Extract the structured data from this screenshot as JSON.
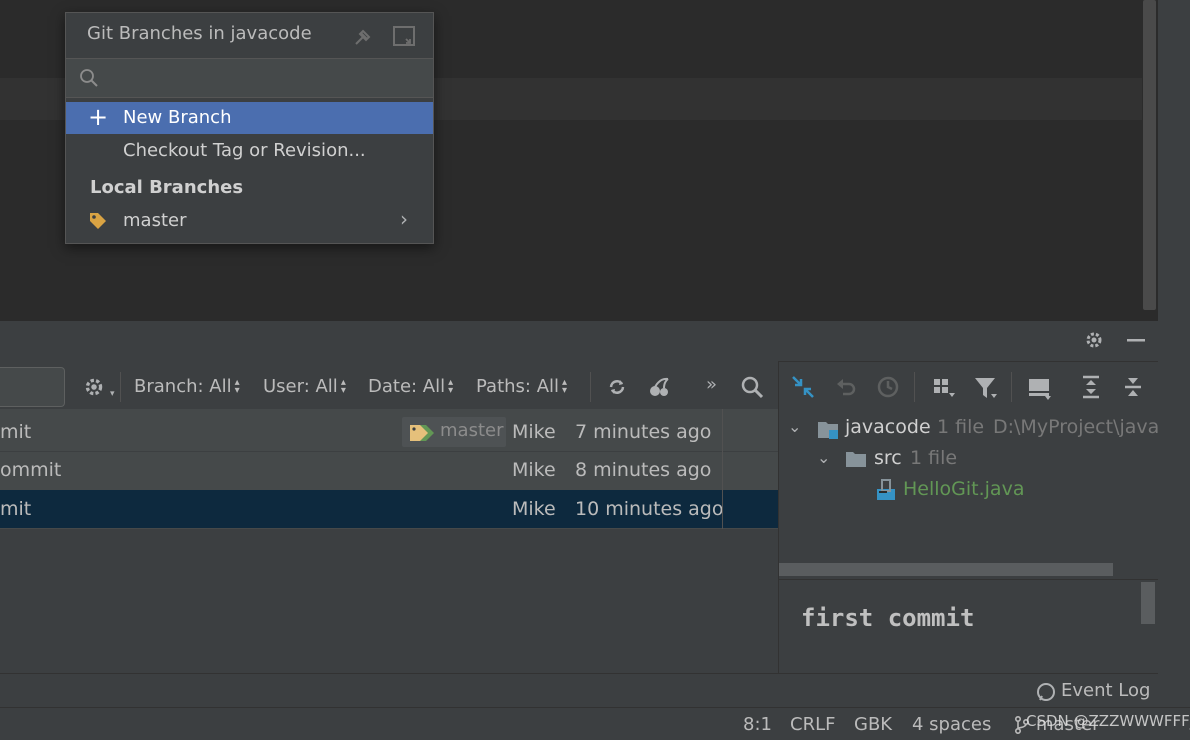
{
  "popup": {
    "title": "Git Branches in javacode",
    "search_placeholder": "",
    "items": [
      {
        "label": "New Branch",
        "selected": true
      },
      {
        "label": "Checkout Tag or Revision...",
        "selected": false
      }
    ],
    "section_title": "Local Branches",
    "branches": [
      {
        "label": "master"
      }
    ]
  },
  "log_toolbar": {
    "branch": "Branch: All",
    "user": "User: All",
    "date": "Date: All",
    "paths": "Paths: All",
    "more": "»"
  },
  "log_rows": [
    {
      "subject": "mit",
      "tag": "master",
      "author": "Mike",
      "time": "7 minutes ago",
      "selected": false
    },
    {
      "subject": "ommit",
      "tag": "",
      "author": "Mike",
      "time": "8 minutes ago",
      "selected": false
    },
    {
      "subject": "mit",
      "tag": "",
      "author": "Mike",
      "time": "10 minutes ago",
      "selected": true
    }
  ],
  "changes_tree": {
    "root": {
      "name": "javacode",
      "count": "1 file",
      "path": "D:\\MyProject\\java"
    },
    "folder": {
      "name": "src",
      "count": "1 file"
    },
    "file": {
      "name": "HelloGit.java"
    }
  },
  "commit_message": "first commit",
  "event_log": "Event Log",
  "status_bar": {
    "position": "8:1",
    "line_sep": "CRLF",
    "encoding": "GBK",
    "indent": "4 spaces",
    "branch": "master",
    "watermark": "CSDN @ZZZWWWFFF_"
  },
  "colors": {
    "selection_popup": "#4b6eaf",
    "selection_log": "#0d293e",
    "file_green": "#629755",
    "tag_yellow": "#e5c07b"
  }
}
